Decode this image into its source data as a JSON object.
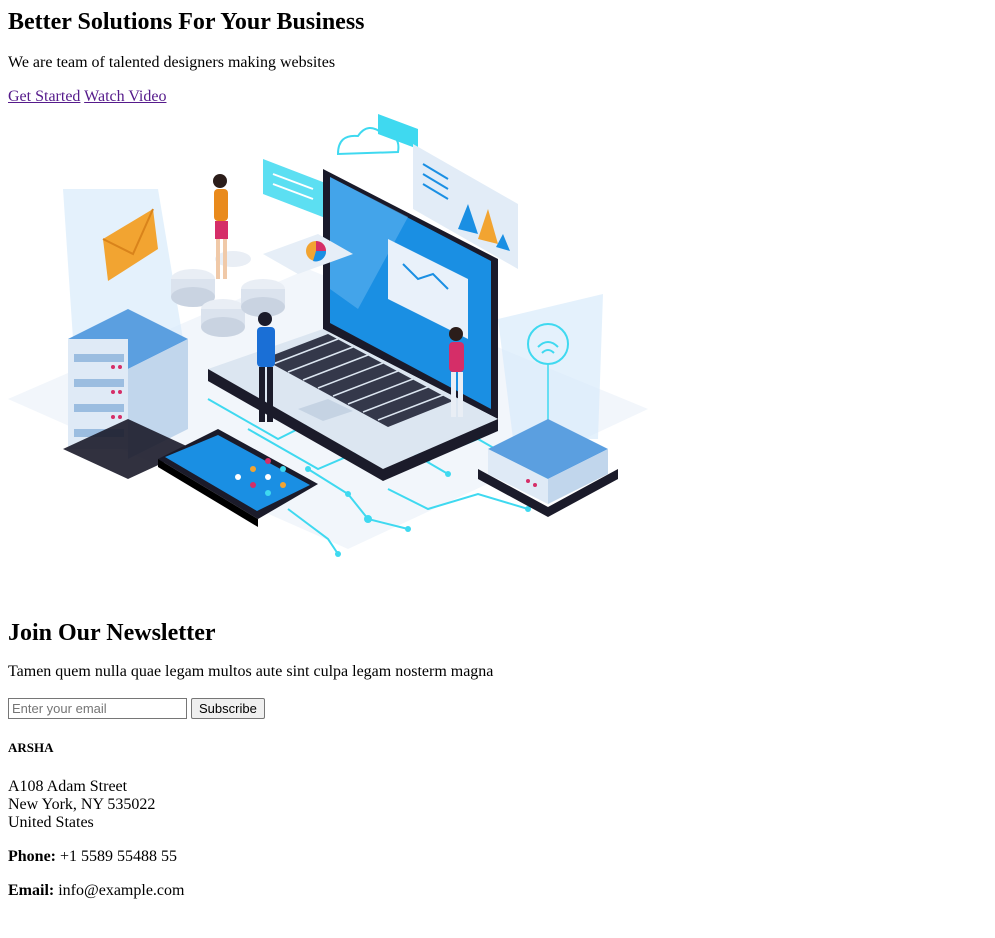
{
  "hero": {
    "title": "Better Solutions For Your Business",
    "subtitle": "We are team of talented designers making websites",
    "get_started": "Get Started",
    "watch_video": "Watch Video"
  },
  "newsletter": {
    "title": "Join Our Newsletter",
    "subtitle": "Tamen quem nulla quae legam multos aute sint culpa legam nosterm magna",
    "email_placeholder": "Enter your email",
    "subscribe_label": "Subscribe"
  },
  "footer": {
    "brand": "ARSHA",
    "address_line1": "A108 Adam Street",
    "address_line2": "New York, NY 535022",
    "address_line3": "United States",
    "phone_label": "Phone:",
    "phone_value": "+1 5589 55488 55",
    "email_label": "Email:",
    "email_value": "info@example.com"
  },
  "colors": {
    "link_visited": "#551a8b",
    "accent_blue": "#1a8fe3",
    "cyan": "#3fd9f0"
  }
}
